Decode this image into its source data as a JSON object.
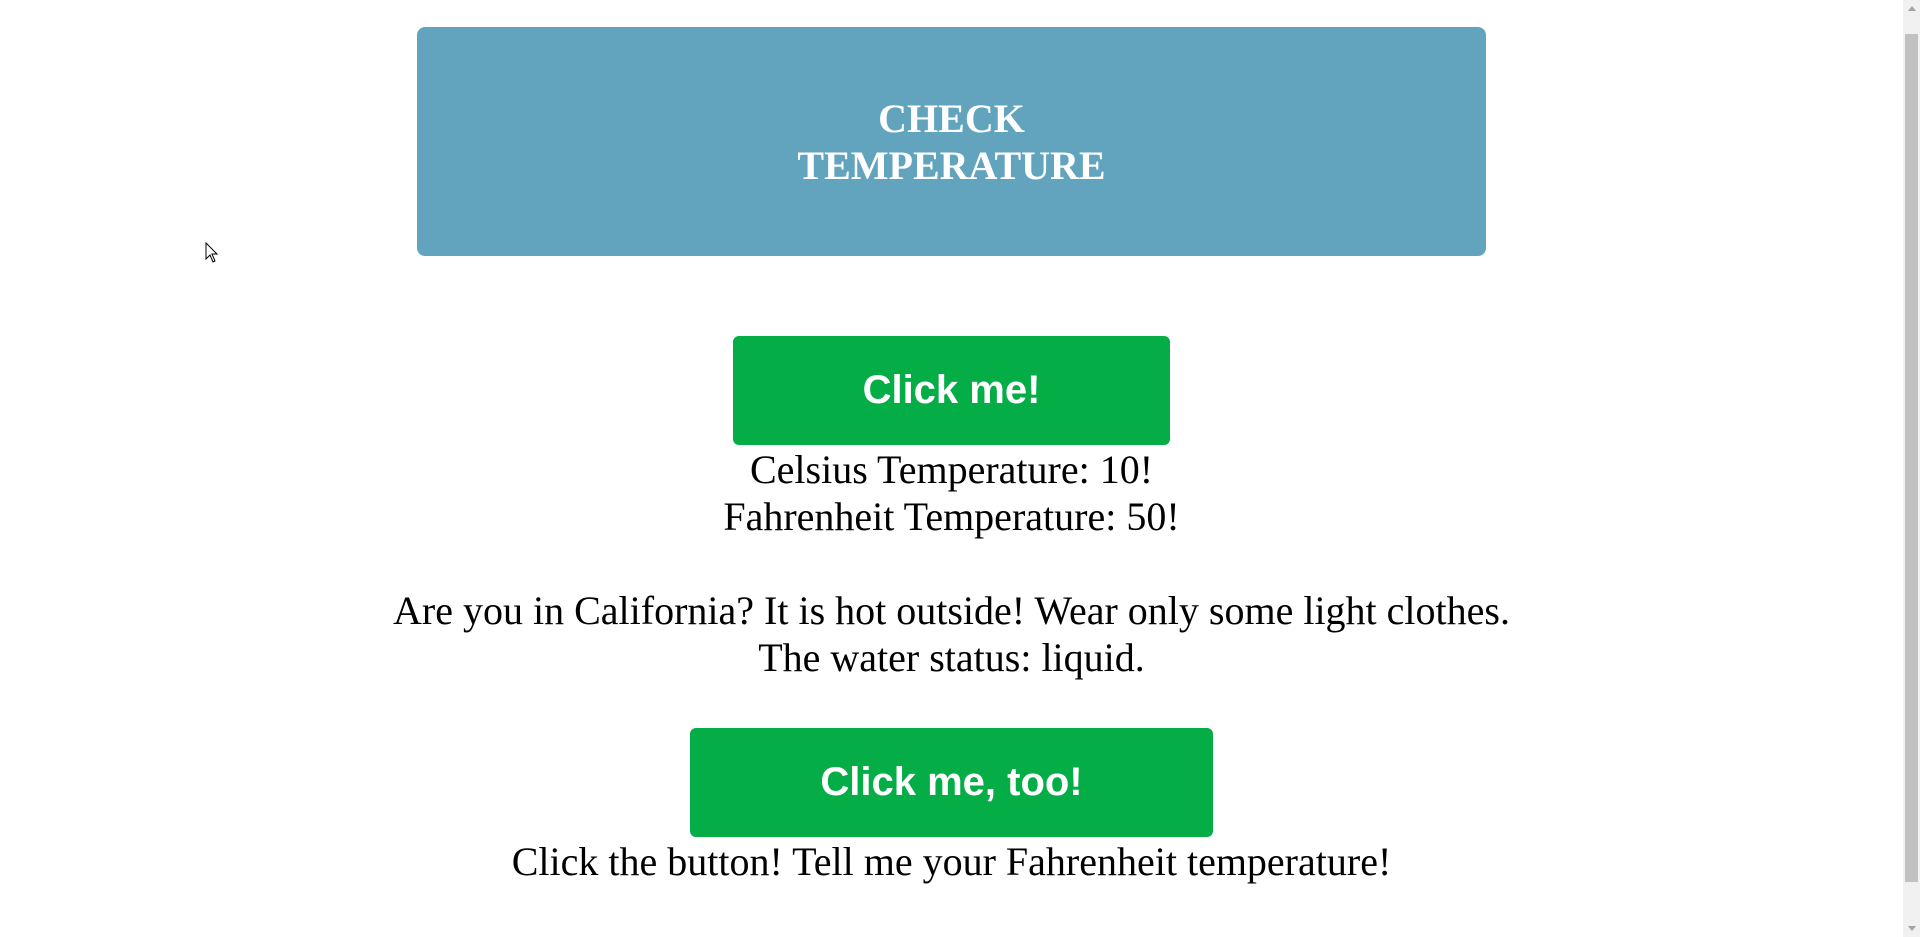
{
  "header": {
    "title": "CHECK TEMPERATURE"
  },
  "buttons": {
    "click_me_label": "Click me!",
    "click_me_too_label": "Click me, too!"
  },
  "results": {
    "celsius_text": "Celsius Temperature: 10!",
    "fahrenheit_text": "Fahrenheit Temperature: 50!",
    "california_text": "Are you in California? It is hot outside! Wear only some light clothes.",
    "water_status_text": "The water status: liquid.",
    "prompt_text": "Click the button! Tell me your Fahrenheit temperature!"
  },
  "colors": {
    "header_bg": "#62a4be",
    "button_bg": "#04ad46"
  },
  "icons": {
    "cursor": "mouse-pointer-icon",
    "scroll_up": "chevron-up-icon",
    "scroll_down": "chevron-down-icon"
  }
}
